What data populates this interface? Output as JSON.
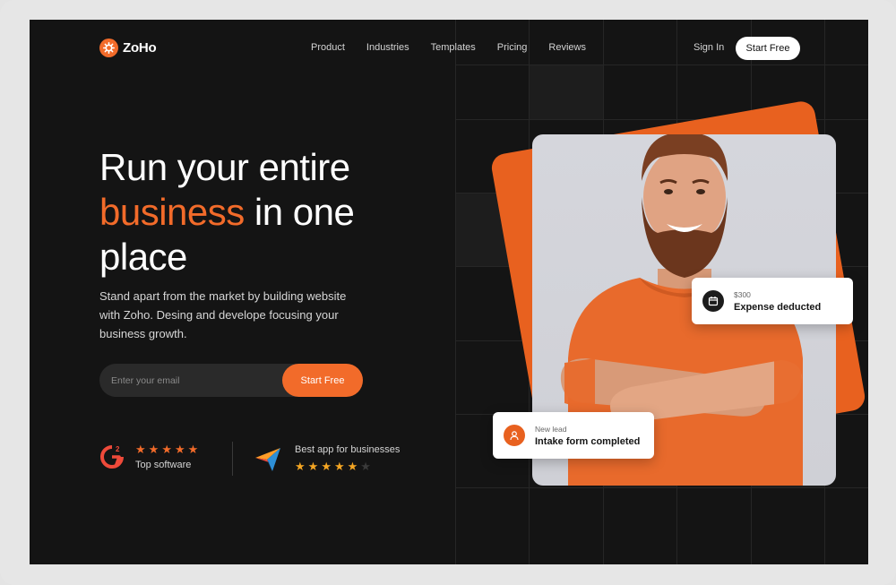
{
  "brand": {
    "name": "ZoHo"
  },
  "nav": {
    "items": [
      "Product",
      "Industries",
      "Templates",
      "Pricing",
      "Reviews"
    ],
    "signin": "Sign In",
    "cta": "Start Free"
  },
  "hero": {
    "line1": "Run your entire",
    "accent": "business",
    "line2_rest": " in one",
    "line3": "place",
    "subtitle": "Stand apart from the market by building website with Zoho. Desing and develope focusing your business growth.",
    "email_placeholder": "Enter your email",
    "email_cta": "Start Free"
  },
  "ratings": {
    "g2": {
      "label": "Top software",
      "stars": 5
    },
    "capterra": {
      "label": "Best app for businesses",
      "stars": 5
    }
  },
  "notifications": {
    "expense": {
      "amount": "$300",
      "title": "Expense deducted"
    },
    "lead": {
      "caption": "New lead",
      "title": "Intake form completed"
    }
  },
  "colors": {
    "accent": "#f26b2a",
    "background": "#141414",
    "star_gold": "#f5a623"
  },
  "icons": [
    "logo-icon",
    "calendar-icon",
    "user-icon",
    "g2-icon",
    "capterra-icon",
    "star-icon"
  ]
}
